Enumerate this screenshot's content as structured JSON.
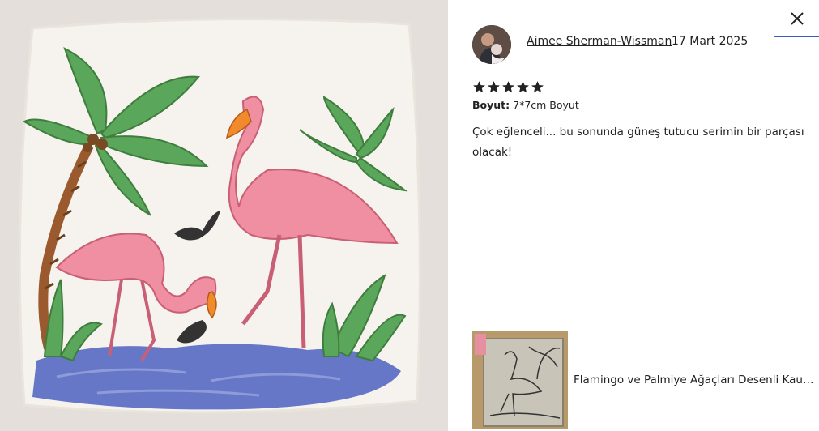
{
  "photo": {
    "alt": "flamingo-palm-clay-tile"
  },
  "close": {
    "icon": "close-icon"
  },
  "review": {
    "reviewer_name": "Aimee Sherman-Wissman",
    "date": "17 Mart 2025",
    "rating": 5,
    "max_rating": 5,
    "size_label": "Boyut:",
    "size_value": "7*7cm Boyut",
    "text": "Çok eğlenceli... bu sonunda güneş tutucu serimin bir parçası olacak!"
  },
  "product": {
    "title": "Flamingo ve Palmiye Ağaçları Desenli Kauçuk Damga"
  },
  "colors": {
    "text": "#222222",
    "star": "#222222",
    "close_border": "#3b5fc7",
    "photo_bg": "#e2ddd8"
  }
}
